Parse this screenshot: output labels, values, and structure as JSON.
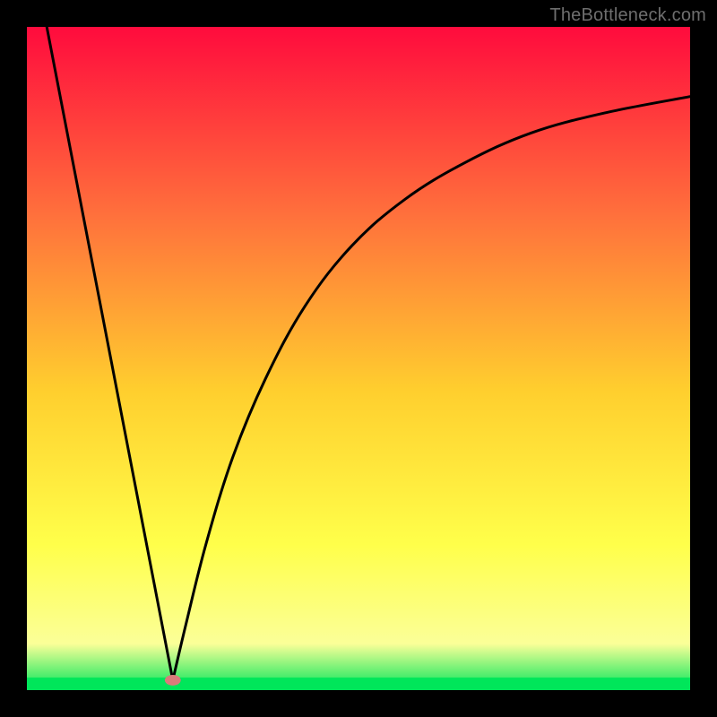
{
  "watermark": "TheBottleneck.com",
  "chart_data": {
    "type": "line",
    "title": "",
    "xlabel": "",
    "ylabel": "",
    "xlim": [
      0,
      1
    ],
    "ylim": [
      0,
      1
    ],
    "background_gradient": {
      "top": "#ff0b3d",
      "mid1": "#ff6f3c",
      "mid2": "#ffcf2e",
      "mid3": "#ffff4a",
      "bottom_band": "#fbff98",
      "ground": "#00e65a"
    },
    "marker": {
      "x": 0.22,
      "y": 0.015,
      "color": "#d97b7b",
      "rx": 0.012,
      "ry": 0.008
    },
    "series": [
      {
        "name": "left-branch",
        "description": "steep descending line",
        "points": [
          {
            "x": 0.03,
            "y": 1.0
          },
          {
            "x": 0.22,
            "y": 0.015
          }
        ]
      },
      {
        "name": "right-branch",
        "description": "rising saturating curve",
        "points": [
          {
            "x": 0.22,
            "y": 0.015
          },
          {
            "x": 0.24,
            "y": 0.1
          },
          {
            "x": 0.27,
            "y": 0.22
          },
          {
            "x": 0.31,
            "y": 0.35
          },
          {
            "x": 0.36,
            "y": 0.47
          },
          {
            "x": 0.42,
            "y": 0.58
          },
          {
            "x": 0.49,
            "y": 0.67
          },
          {
            "x": 0.57,
            "y": 0.74
          },
          {
            "x": 0.66,
            "y": 0.795
          },
          {
            "x": 0.76,
            "y": 0.84
          },
          {
            "x": 0.87,
            "y": 0.87
          },
          {
            "x": 1.0,
            "y": 0.895
          }
        ]
      }
    ]
  }
}
